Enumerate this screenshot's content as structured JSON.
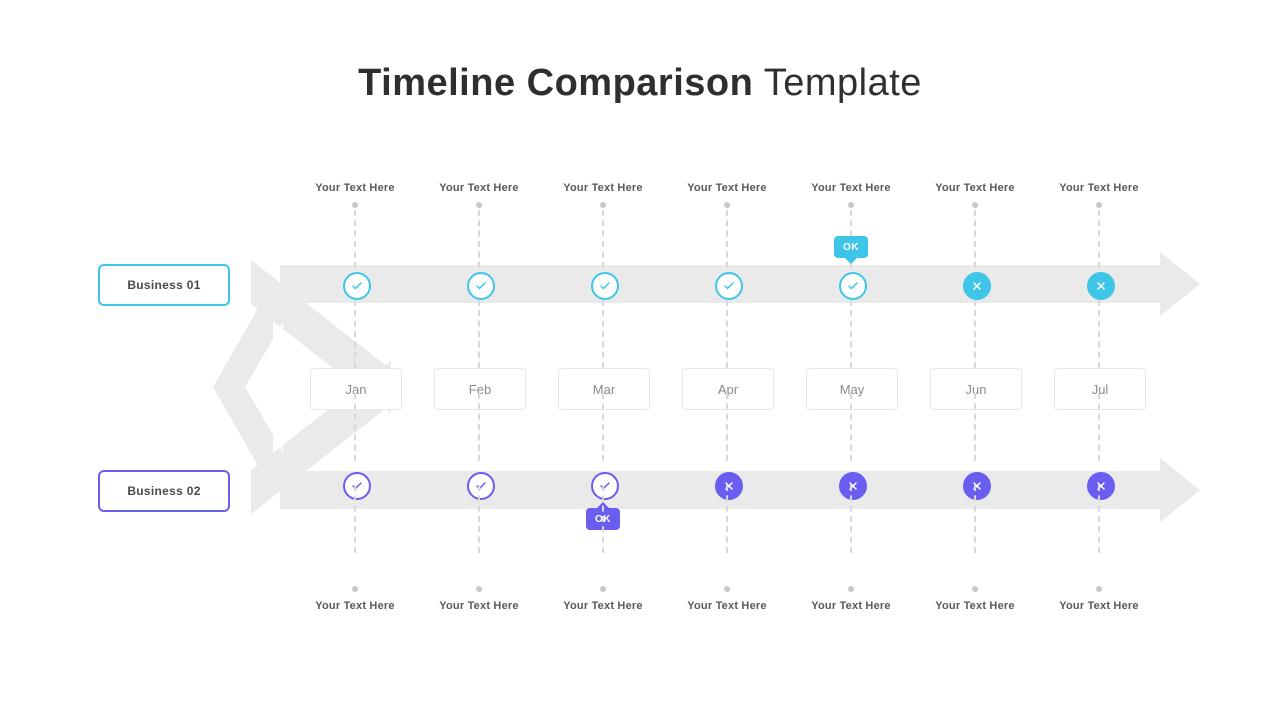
{
  "title": {
    "bold": "Timeline Comparison",
    "light": " Template"
  },
  "business1": {
    "label": "Business 01",
    "color": "#3ec6e8",
    "okBubble": {
      "text": "OK",
      "index": 4
    }
  },
  "business2": {
    "label": "Business 02",
    "color": "#6a5df0",
    "okBubble": {
      "text": "OK",
      "index": 2
    }
  },
  "months": [
    "Jan",
    "Feb",
    "Mar",
    "Apr",
    "May",
    "Jun",
    "Jul"
  ],
  "placeholder": "Your Text Here",
  "row1": [
    {
      "state": "check",
      "topLabel": "Your Text Here"
    },
    {
      "state": "check",
      "topLabel": "Your Text Here"
    },
    {
      "state": "check",
      "topLabel": "Your Text Here"
    },
    {
      "state": "check",
      "topLabel": "Your Text Here"
    },
    {
      "state": "check",
      "topLabel": "Your Text Here",
      "ok": true
    },
    {
      "state": "x",
      "topLabel": "Your Text Here"
    },
    {
      "state": "x",
      "topLabel": "Your Text Here"
    }
  ],
  "row2": [
    {
      "state": "check",
      "botLabel": "Your Text Here"
    },
    {
      "state": "check",
      "botLabel": "Your Text Here"
    },
    {
      "state": "check",
      "botLabel": "Your Text Here",
      "ok": true
    },
    {
      "state": "x",
      "botLabel": "Your Text Here"
    },
    {
      "state": "x",
      "botLabel": "Your Text Here"
    },
    {
      "state": "x",
      "botLabel": "Your Text Here"
    },
    {
      "state": "x",
      "botLabel": "Your Text Here"
    }
  ]
}
